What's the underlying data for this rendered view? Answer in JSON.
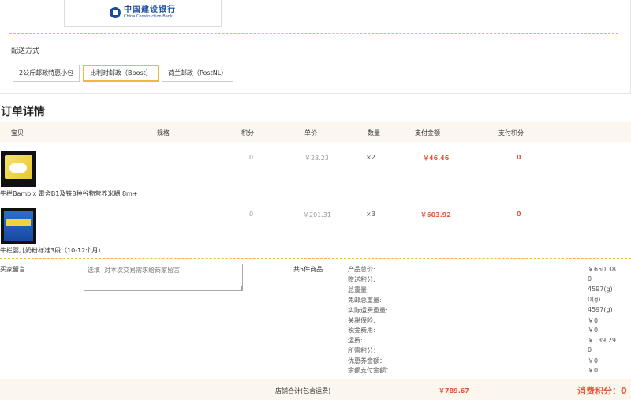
{
  "bank": {
    "name_cn": "中国建设银行",
    "name_en": "China Construction Bank"
  },
  "shipping": {
    "title": "配送方式",
    "options": [
      "2公斤邮政特惠小包",
      "比利时邮政（Bpost）",
      "荷兰邮政（PostNL）"
    ],
    "selected": "比利时邮政（Bpost）"
  },
  "order": {
    "title": "订单详情",
    "columns": [
      "宝贝",
      "规格",
      "积分",
      "单价",
      "数量",
      "支付金额",
      "支付积分"
    ],
    "items": [
      {
        "name": "牛栏Bambix 雷舍B1及铁8种谷物营养米糊 8m+",
        "points": "0",
        "price": "￥23.23",
        "qty": "×2",
        "amount": "￥46.46",
        "pay_points": "0"
      },
      {
        "name": "牛栏婴儿奶粉标准3段（10-12个月）",
        "points": "0",
        "price": "￥201.31",
        "qty": "×3",
        "amount": "￥603.92",
        "pay_points": "0"
      }
    ]
  },
  "buyer": {
    "label": "买家留言",
    "placeholder": "选填  对本次交易需求给商家留言",
    "item_count": "共5件商品"
  },
  "summary": [
    {
      "label": "产品总价:",
      "value": "￥650.38"
    },
    {
      "label": "赠送积分:",
      "value": "0"
    },
    {
      "label": "总重量:",
      "value": "4597(g)"
    },
    {
      "label": "免邮总重量:",
      "value": "0(g)"
    },
    {
      "label": "实际运费重量:",
      "value": "4597(g)"
    },
    {
      "label": "关税保险:",
      "value": "￥0"
    },
    {
      "label": "税金费用:",
      "value": "￥0"
    },
    {
      "label": "运费:",
      "value": "￥139.29"
    },
    {
      "label": "所需积分：",
      "value": "0"
    },
    {
      "label": "优惠券金额：",
      "value": "￥0"
    },
    {
      "label": "余额支付金额：",
      "value": "￥0"
    }
  ],
  "footer": {
    "total_label": "店铺合计(包含运费)",
    "total": "￥789.67",
    "points_label": "消费积分：0"
  },
  "colors": {
    "accent": "#f0b93a",
    "price_red": "#e4563a",
    "header_bg": "#fbf7ee"
  }
}
